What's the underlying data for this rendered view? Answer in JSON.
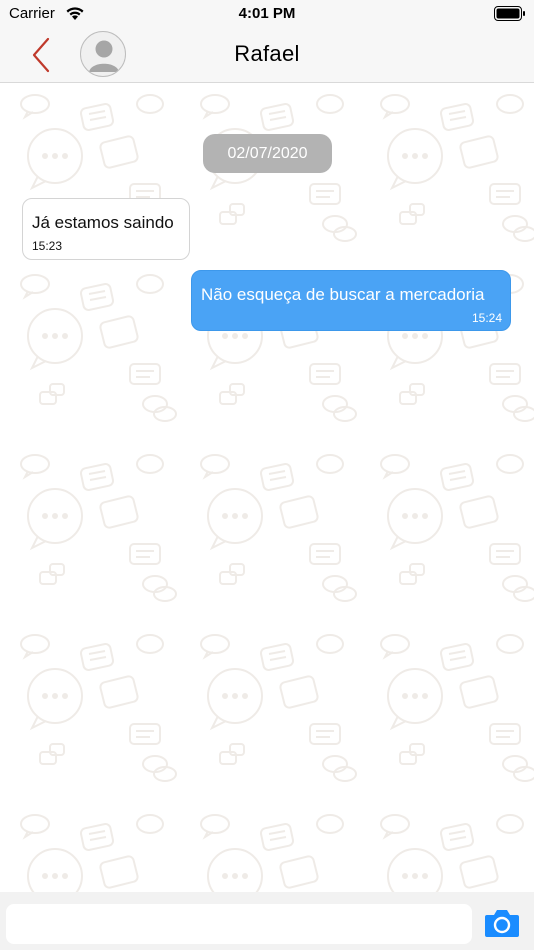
{
  "status_bar": {
    "carrier": "Carrier",
    "time": "4:01 PM",
    "wifi_icon": "wifi-icon",
    "battery_icon": "battery-icon"
  },
  "nav": {
    "title": "Rafael",
    "back_icon": "chevron-left-icon",
    "avatar_icon": "person-icon",
    "accent_color": "#c0392b"
  },
  "chat": {
    "date_separator": "02/07/2020",
    "messages": [
      {
        "direction": "incoming",
        "text": "Já estamos saindo",
        "time": "15:23"
      },
      {
        "direction": "outgoing",
        "text": "Não esqueça de buscar a mercadoria",
        "time": "15:24"
      }
    ],
    "incoming_bubble_color": "#ffffff",
    "outgoing_bubble_color": "#4aa3f5"
  },
  "composer": {
    "input_value": "",
    "input_placeholder": "",
    "camera_icon": "camera-icon",
    "camera_color": "#1a8cff"
  }
}
